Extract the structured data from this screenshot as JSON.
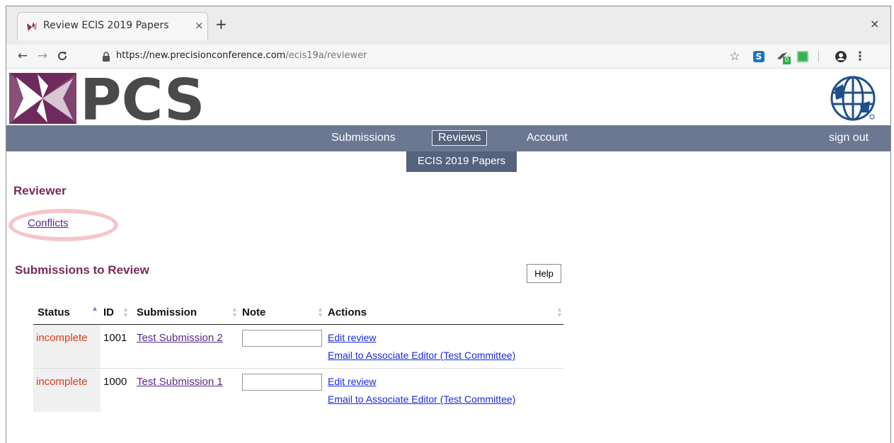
{
  "browser": {
    "tab_title": "Review ECIS 2019 Papers",
    "tab_close": "×",
    "new_tab": "+",
    "window_close": "×",
    "url_host": "https://new.precisionconference.com",
    "url_path": "/ecis19a/reviewer",
    "extension_badge": "0",
    "extension_s_label": "S"
  },
  "brand": {
    "logo_text": "PCS"
  },
  "nav": {
    "items": [
      {
        "label": "Submissions"
      },
      {
        "label": "Reviews",
        "active": true
      },
      {
        "label": "Account"
      }
    ],
    "signout": "sign out",
    "subnav": "ECIS 2019 Papers"
  },
  "page": {
    "reviewer_heading": "Reviewer",
    "conflicts_link": "Conflicts",
    "submissions_heading": "Submissions to Review",
    "help_button": "Help"
  },
  "table": {
    "headers": [
      "Status",
      "ID",
      "Submission",
      "Note",
      "Actions"
    ],
    "rows": [
      {
        "status": "incomplete",
        "id": "1001",
        "submission": "Test Submission 2",
        "note": "",
        "edit": "Edit review",
        "email": "Email to Associate Editor (Test Committee)"
      },
      {
        "status": "incomplete",
        "id": "1000",
        "submission": "Test Submission 1",
        "note": "",
        "edit": "Edit review",
        "email": "Email to Associate Editor (Test Committee)"
      }
    ]
  },
  "colors": {
    "navbar": "#6b7891",
    "heading": "#7a2a5a",
    "status_incomplete": "#e03a1c",
    "link": "#1a2ae0",
    "visited_link": "#5a2a8a",
    "logo_purple": "#6e2a5c",
    "logo_gray": "#4a4a4a"
  }
}
